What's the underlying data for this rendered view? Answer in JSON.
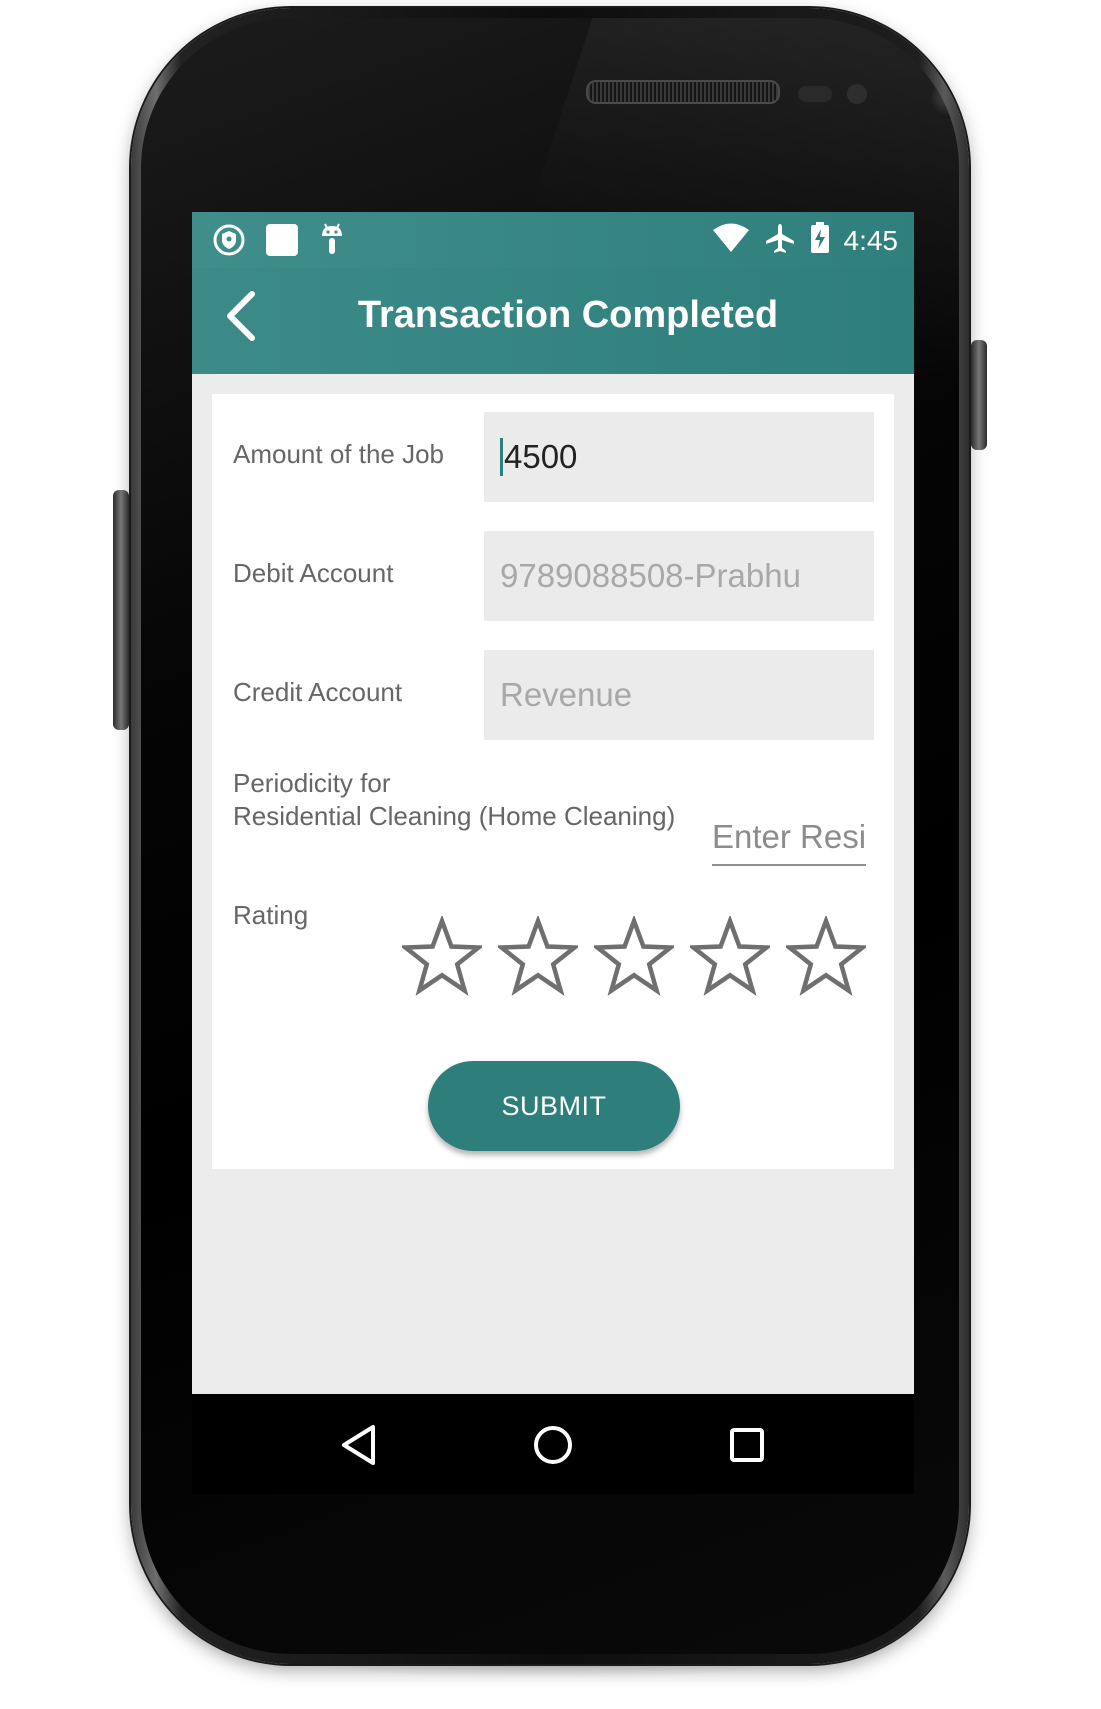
{
  "status_bar": {
    "left_icons": [
      "shield-notification-icon",
      "square-notification-icon",
      "android-notification-icon"
    ],
    "right_icons": [
      "wifi-icon",
      "airplane-mode-icon",
      "battery-charging-icon"
    ],
    "time": "4:45"
  },
  "app_bar": {
    "back_icon": "chevron-left-icon",
    "title": "Transaction Completed",
    "color": "#2e7e7c"
  },
  "form": {
    "amount": {
      "label": "Amount of the Job",
      "value": "4500"
    },
    "debit": {
      "label": "Debit Account",
      "value": "9789088508-Prabhu"
    },
    "credit": {
      "label": "Credit Account",
      "value": "Revenue"
    },
    "periodicity": {
      "label_line1": "Periodicity for",
      "label_line2": "Residential Cleaning (Home Cleaning)",
      "placeholder": "Enter Resi"
    },
    "rating": {
      "label": "Rating",
      "max": 5,
      "value": 0
    },
    "submit_label": "SUBMIT"
  },
  "nav_bar": {
    "icons": [
      "back-triangle-icon",
      "home-circle-icon",
      "recents-square-icon"
    ]
  }
}
